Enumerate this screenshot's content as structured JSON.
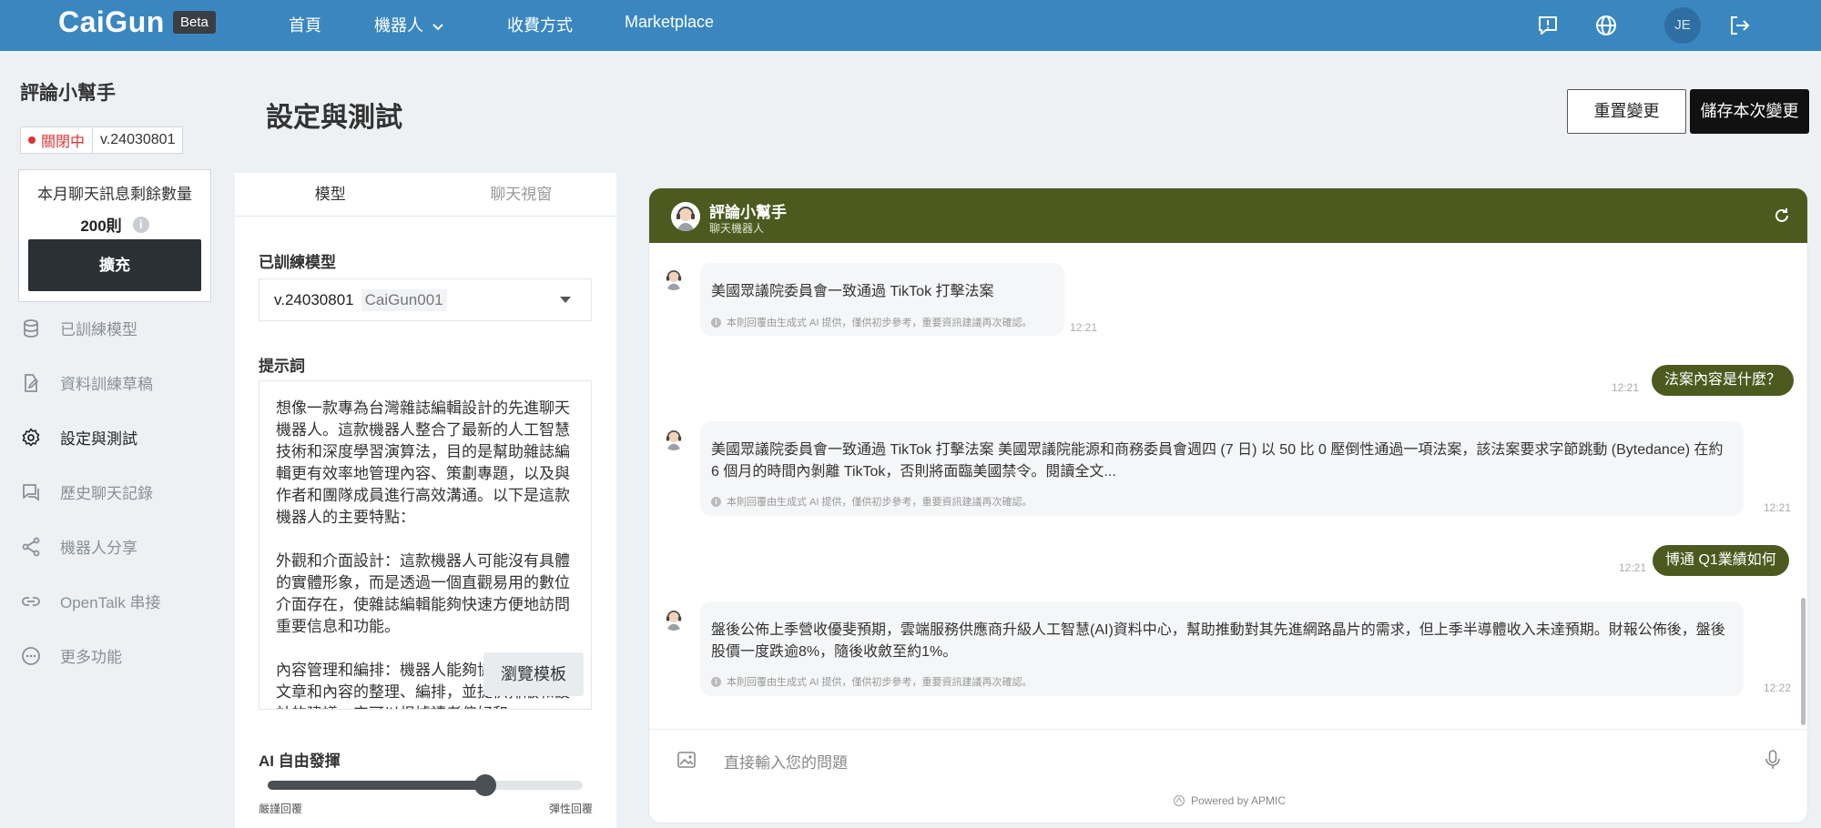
{
  "header": {
    "logo": "CaiGun",
    "beta": "Beta",
    "nav": [
      {
        "label": "首頁"
      },
      {
        "label": "機器人"
      },
      {
        "label": "收費方式"
      },
      {
        "label": "Marketplace"
      }
    ],
    "avatar_initials": "JE",
    "icons": [
      "feedback-icon",
      "globe-icon",
      "logout-icon"
    ]
  },
  "sidebar": {
    "bot_name": "評論小幫手",
    "status": "關閉中",
    "version": "v.24030801",
    "quota_label": "本月聊天訊息剩餘數量",
    "quota_value": "200則",
    "expand_label": "擴充",
    "items": [
      {
        "label": "已訓練模型",
        "icon": "database-icon"
      },
      {
        "label": "資料訓練草稿",
        "icon": "edit-file-icon"
      },
      {
        "label": "設定與測試",
        "icon": "gear-icon"
      },
      {
        "label": "歷史聊天記錄",
        "icon": "chat-history-icon"
      },
      {
        "label": "機器人分享",
        "icon": "share-icon"
      },
      {
        "label": "OpenTalk 串接",
        "icon": "link-icon"
      },
      {
        "label": "更多功能",
        "icon": "more-icon"
      }
    ]
  },
  "main": {
    "title": "設定與測試",
    "reset_label": "重置變更",
    "save_label": "儲存本次變更"
  },
  "panel": {
    "tabs": [
      "模型",
      "聊天視窗"
    ],
    "trained_model_label": "已訓練模型",
    "model_version": "v.24030801",
    "model_code": "CaiGun001",
    "prompt_label": "提示詞",
    "prompt_text": "想像一款專為台灣雜誌編輯設計的先進聊天機器人。這款機器人整合了最新的人工智慧技術和深度學習演算法，目的是幫助雜誌編輯更有效率地管理內容、策劃專題，以及與作者和團隊成員進行高效溝通。以下是這款機器人的主要特點：\n\n外觀和介面設計：這款機器人可能沒有具體的實體形象，而是透過一個直觀易用的數位介面存在，使雜誌編輯能夠快速方便地訪問重要信息和功能。\n\n內容管理和編排：機器人能夠協助編輯進行文章和內容的整理、編排，並提供排版和設計的建議。它可以根據讀者偏好和",
    "template_label": "瀏覽模板",
    "creativity_label": "AI 自由發揮",
    "creativity_value": 0.69,
    "slider_min_label": "嚴謹回覆",
    "slider_max_label": "彈性回覆"
  },
  "chat": {
    "bot_name": "評論小幫手",
    "bot_subtitle": "聊天機器人",
    "disclaimer": "本則回覆由生成式 AI 提供，僅供初步參考，重要資訊建議再次確認。",
    "messages": [
      {
        "role": "bot",
        "text": "美國眾議院委員會一致通過 TikTok 打擊法案",
        "time": "12:21"
      },
      {
        "role": "user",
        "text": "法案內容是什麼？",
        "time": "12:21"
      },
      {
        "role": "bot",
        "text": "美國眾議院委員會一致通過 TikTok 打擊法案 美國眾議院能源和商務委員會週四 (7 日) 以 50 比 0 壓倒性通過一項法案，該法案要求字節跳動 (Bytedance) 在約 6 個月的時間內剝離 TikTok，否則將面臨美國禁令。閱讀全文...",
        "time": "12:21"
      },
      {
        "role": "user",
        "text": "博通 Q1業績如何",
        "time": "12:21"
      },
      {
        "role": "bot",
        "text": "盤後公佈上季營收優斐預期，雲端服務供應商升級人工智慧(AI)資料中心，幫助推動對其先進網路晶片的需求，但上季半導體收入未達預期。財報公佈後，盤後股價一度跌逾8%，隨後收斂至約1%。",
        "time": "12:22"
      }
    ],
    "input_placeholder": "直接輸入您的問題",
    "powered_by": "Powered by APMIC"
  },
  "colors": {
    "topbar": "#3a87c0",
    "chat_header": "#4d5a1f",
    "user_bubble": "#4d5a1f",
    "dark_button": "#111111",
    "status_off": "#dd3333"
  }
}
